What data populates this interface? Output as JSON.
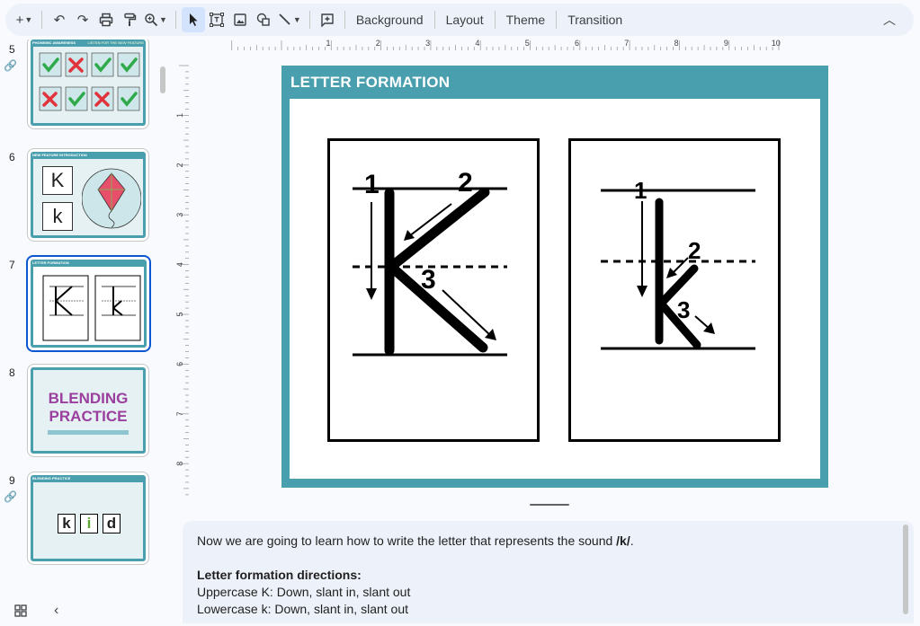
{
  "toolbar": {
    "new_label": "+",
    "undo_icon": "undo-icon",
    "redo_icon": "redo-icon",
    "print_icon": "print-icon",
    "paint_format_icon": "paint-format-icon",
    "zoom_icon": "zoom-icon",
    "select_icon": "cursor-icon",
    "textbox_icon": "textbox-icon",
    "image_icon": "image-icon",
    "shape_icon": "shape-icon",
    "line_icon": "line-icon",
    "comment_icon": "add-comment-icon",
    "background_label": "Background",
    "layout_label": "Layout",
    "theme_label": "Theme",
    "transition_label": "Transition"
  },
  "ruler": {
    "h_labels": [
      "1",
      "2",
      "3",
      "4",
      "5",
      "6",
      "7",
      "8",
      "9",
      "10"
    ],
    "v_labels": [
      "1",
      "2",
      "3",
      "4",
      "5",
      "6",
      "7",
      "8"
    ]
  },
  "filmstrip": {
    "slides": [
      {
        "num": "5",
        "title": "PHONEMIC AWARENESS",
        "subtitle": "LISTEN FOR THE NEW FEATURE",
        "linked": true
      },
      {
        "num": "6",
        "title": "NEW FEATURE INTRODUCTION",
        "letters": [
          "K",
          "k"
        ],
        "linked": false
      },
      {
        "num": "7",
        "title": "LETTER FORMATION",
        "linked": false,
        "selected": true
      },
      {
        "num": "8",
        "lines": [
          "BLENDING",
          "PRACTICE"
        ],
        "linked": false
      },
      {
        "num": "9",
        "title": "BLENDING PRACTICE",
        "tiles": [
          "k",
          "i",
          "d"
        ],
        "linked": true
      }
    ]
  },
  "slide": {
    "title": "LETTER FORMATION",
    "upper": {
      "steps": [
        "1",
        "2",
        "3"
      ]
    },
    "lower": {
      "steps": [
        "1",
        "2",
        "3"
      ]
    }
  },
  "notes": {
    "line1_prefix": "Now we are going to learn how to write the letter that represents the sound ",
    "line1_sound": "/k/",
    "line1_suffix": ".",
    "heading": "Letter formation directions:",
    "upper": "Uppercase K: Down, slant in, slant out",
    "lower": "Lowercase k: Down, slant in, slant out"
  },
  "colors": {
    "accent": "#4a9fae",
    "selection": "#0b57d0",
    "purple": "#9b3f9e"
  }
}
